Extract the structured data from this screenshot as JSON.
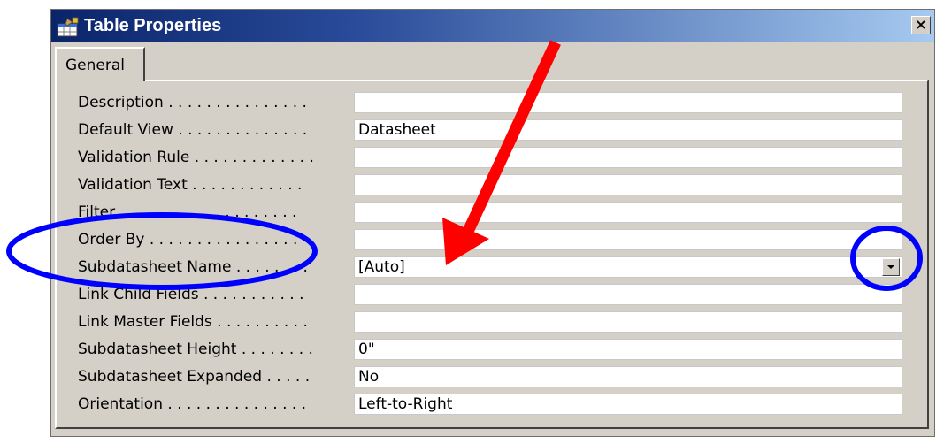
{
  "window": {
    "title": "Table Properties",
    "close_symbol": "×"
  },
  "tabs": [
    {
      "label": "General",
      "active": true
    }
  ],
  "properties": [
    {
      "label": "Description . . . . . . . . . . . . . . .",
      "value": ""
    },
    {
      "label": "Default View . . . . . . . . . . . . . .",
      "value": "Datasheet"
    },
    {
      "label": "Validation Rule . . . . . . . . . . . . .",
      "value": ""
    },
    {
      "label": "Validation Text . . . . . . . . . . . .",
      "value": ""
    },
    {
      "label": "Filter . . . . . . . . . . . . . . . . . . .",
      "value": ""
    },
    {
      "label": "Order By . . . . . . . . . . . . . . . .",
      "value": ""
    },
    {
      "label": "Subdatasheet Name . . . . . . . .",
      "value": "[Auto]",
      "has_dropdown": true
    },
    {
      "label": "Link Child Fields . . . . . . . . . . .",
      "value": ""
    },
    {
      "label": "Link Master Fields . . . . . . . . . .",
      "value": ""
    },
    {
      "label": "Subdatasheet Height . . . . . . . .",
      "value": "0\""
    },
    {
      "label": "Subdatasheet Expanded . . . . .",
      "value": "No"
    },
    {
      "label": "Orientation . . . . . . . . . . . . . . .",
      "value": "Left-to-Right"
    }
  ],
  "icons": {
    "title_icon": "table-properties-icon",
    "close_icon": "close-icon",
    "dropdown_icon": "chevron-down-icon"
  },
  "annotations": {
    "arrow_color": "#ff0000",
    "circle_color": "#0000ff"
  },
  "colors": {
    "titlebar_start": "#0a246a",
    "titlebar_end": "#a6caf0",
    "dialog_bg": "#d4d0c8"
  }
}
